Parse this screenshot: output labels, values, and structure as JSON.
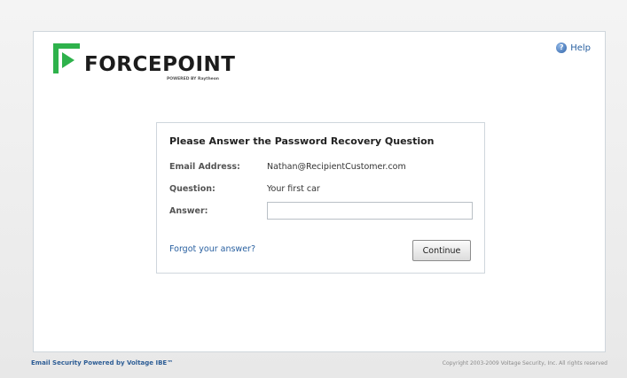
{
  "header": {
    "logo_text": "FORCEPOINT",
    "logo_subtitle": "POWERED BY Raytheon",
    "help_label": "Help"
  },
  "dialog": {
    "title": "Please Answer the Password Recovery Question",
    "email_label": "Email Address:",
    "email_value": "Nathan@RecipientCustomer.com",
    "question_label": "Question:",
    "question_value": "Your first car",
    "answer_label": "Answer:",
    "answer_value": "",
    "forgot_link": "Forgot your answer?",
    "continue_label": "Continue"
  },
  "footer": {
    "left_text": "Email Security Powered by Voltage IBE™",
    "right_text": "Copyright 2003-2009 Voltage Security, Inc. All rights reserved"
  },
  "colors": {
    "brand_green": "#2eb24b",
    "link_blue": "#2960a0",
    "border": "#cfd6dc"
  },
  "icons": {
    "logo_mark": "forcepoint-arrow-mark",
    "help": "help-question-icon"
  }
}
